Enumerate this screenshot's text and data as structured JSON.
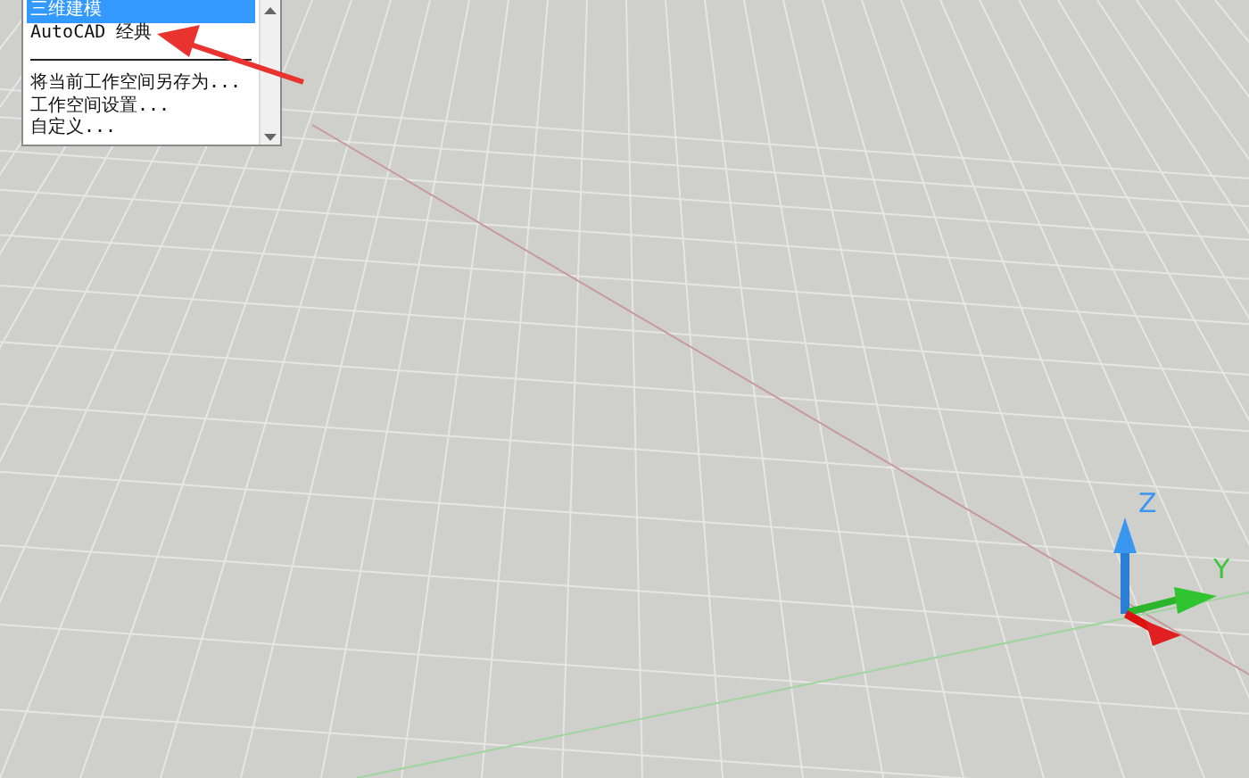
{
  "workspace_menu": {
    "items": [
      {
        "kind": "item",
        "label": "三维建模",
        "selected": true
      },
      {
        "kind": "item",
        "label": "AutoCAD 经典",
        "selected": false
      },
      {
        "kind": "separator"
      },
      {
        "kind": "item",
        "label": "将当前工作空间另存为...",
        "selected": false
      },
      {
        "kind": "item",
        "label": "工作空间设置...",
        "selected": false
      },
      {
        "kind": "item",
        "label": "自定义...",
        "selected": false
      }
    ]
  },
  "ucs_icon": {
    "z_label": "Z",
    "y_label": "Y"
  }
}
